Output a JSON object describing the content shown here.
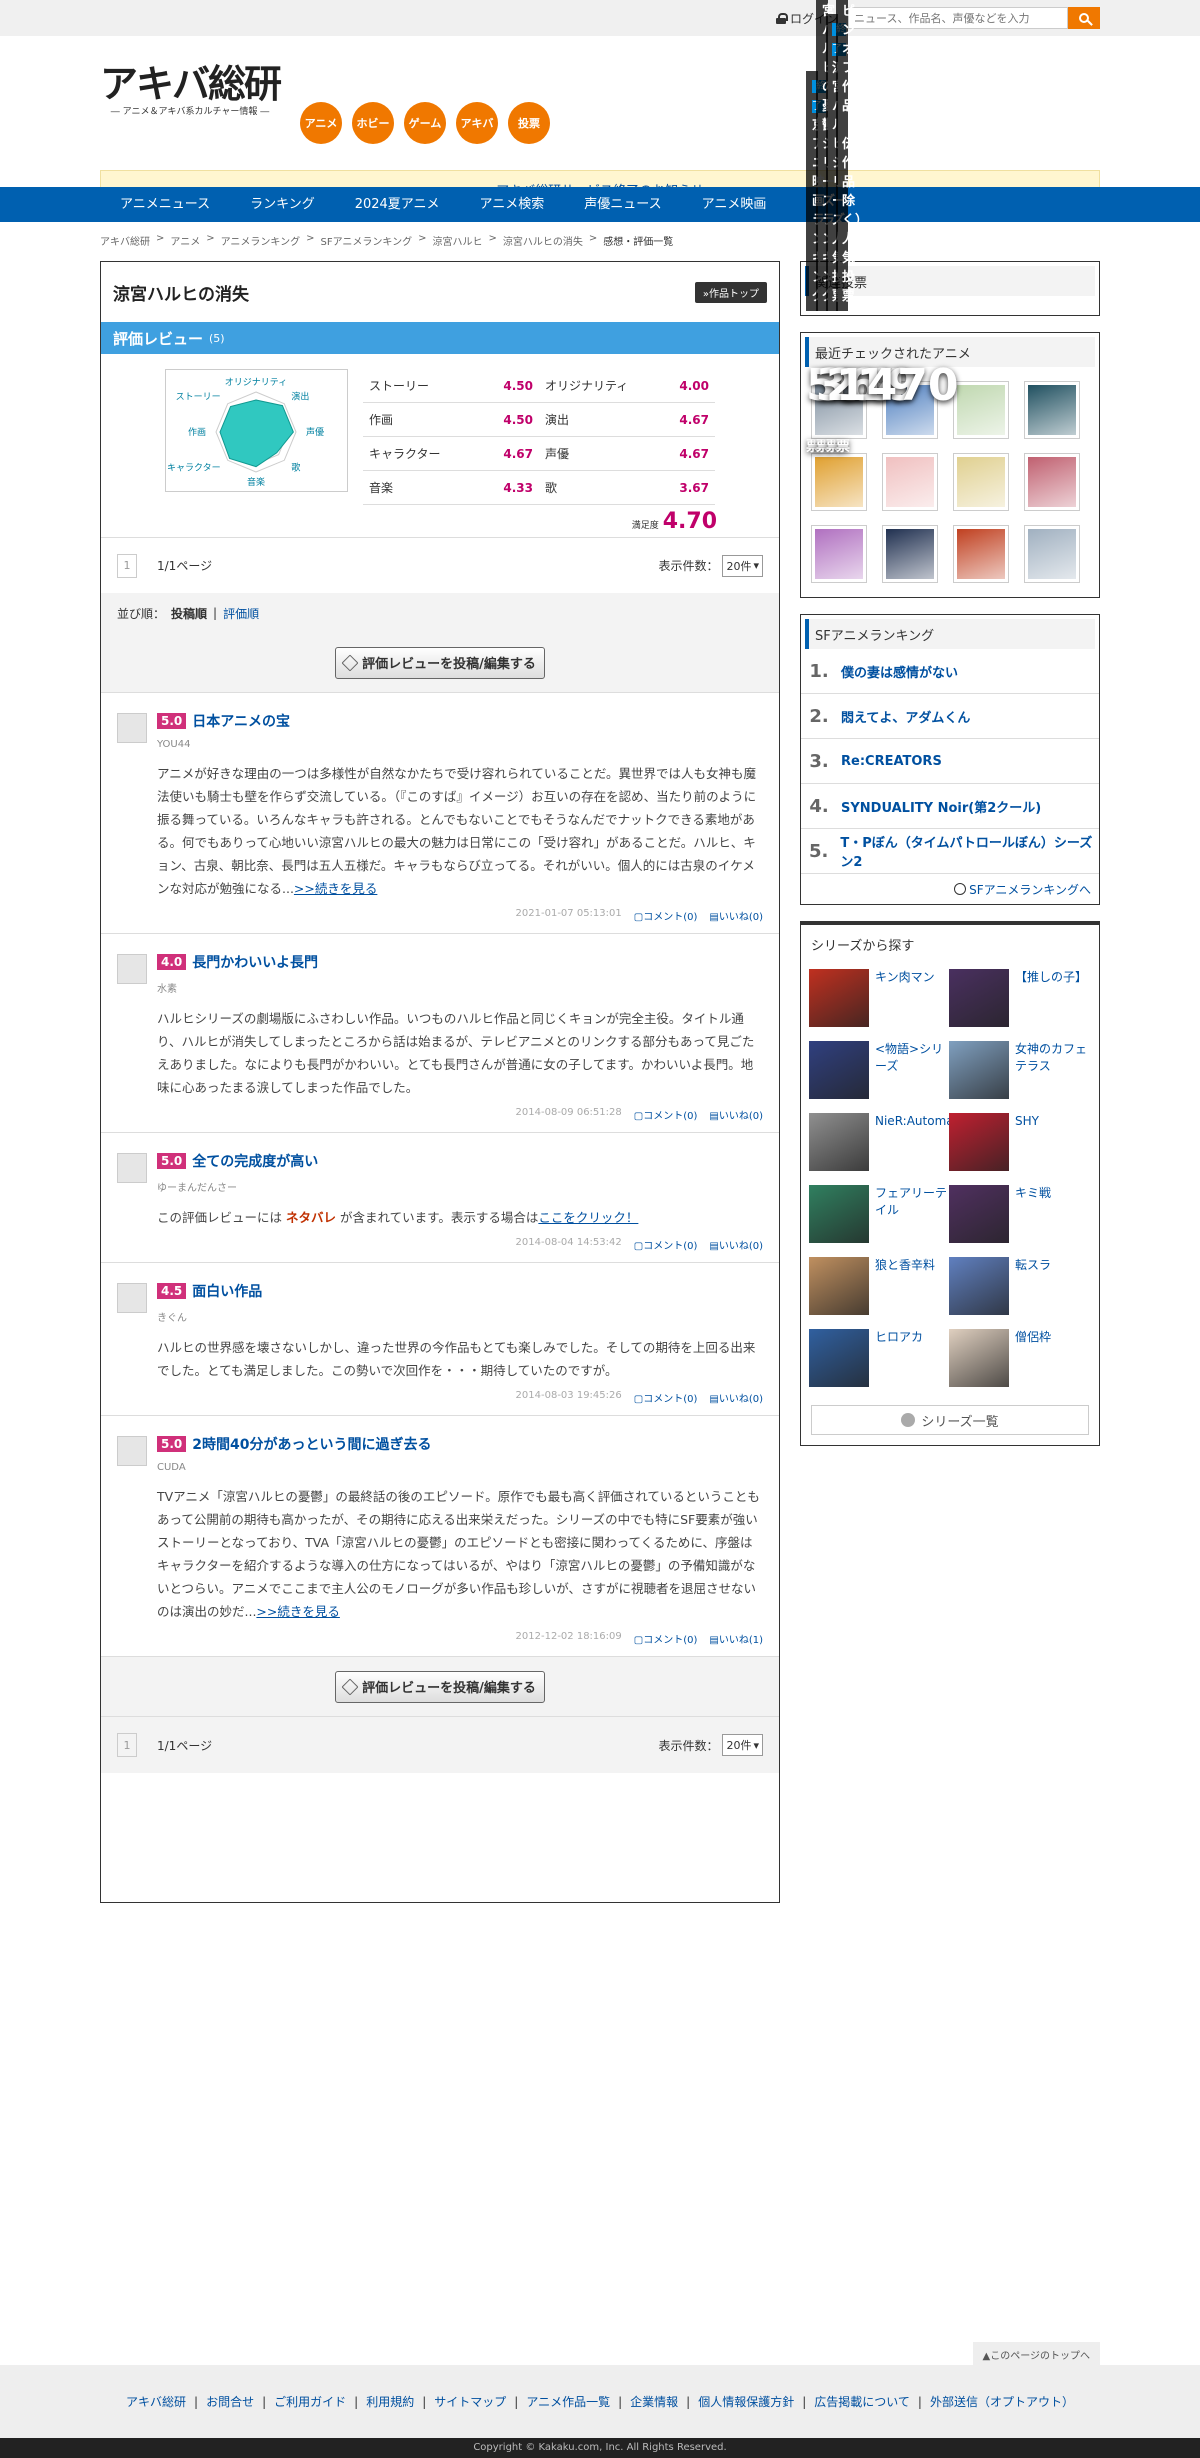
{
  "topbar": {
    "login": "ログイン",
    "search_placeholder": "ニュース、作品名、声優などを入力"
  },
  "logo": {
    "main": "アキバ総研",
    "sub": "― アニメ＆アキバ系カルチャー情報 ―"
  },
  "categories": [
    "アニメ",
    "ホビー",
    "ゲーム",
    "アキバ",
    "投票"
  ],
  "notice": "アキバ総研サービス終了のお知らせ",
  "nav": [
    "アニメニュース",
    "ランキング",
    "2024夏アニメ",
    "アニメ検索",
    "声優ニュース",
    "アニメ映画"
  ],
  "breadcrumb": [
    "アキバ総研",
    "アニメ",
    "アニメランキング",
    "SFアニメランキング",
    "涼宮ハルヒ",
    "涼宮ハルヒの消失",
    "感想・評価一覧"
  ],
  "work": {
    "title": "涼宮ハルヒの消失",
    "top_button": "»作品トップ"
  },
  "reviews_header": {
    "label": "評価レビュー",
    "count": "(5)"
  },
  "radar_labels": [
    "オリジナリティ",
    "演出",
    "声優",
    "歌",
    "音楽",
    "キャラクター",
    "作画",
    "ストーリー"
  ],
  "scores": [
    {
      "label": "ストーリー",
      "value": "4.50"
    },
    {
      "label": "オリジナリティ",
      "value": "4.00"
    },
    {
      "label": "作画",
      "value": "4.50"
    },
    {
      "label": "演出",
      "value": "4.67"
    },
    {
      "label": "キャラクター",
      "value": "4.67"
    },
    {
      "label": "声優",
      "value": "4.67"
    },
    {
      "label": "音楽",
      "value": "4.33"
    },
    {
      "label": "歌",
      "value": "3.67"
    }
  ],
  "overall": {
    "label": "満足度",
    "value": "4.70"
  },
  "pager": {
    "num": "1",
    "pages": "1/1ページ",
    "count_label": "表示件数：",
    "count": "20件"
  },
  "sort": {
    "label": "並び順：",
    "active": "投稿順",
    "other": "評価順"
  },
  "post_button": "評価レビューを投稿/編集する",
  "reviews": [
    {
      "score": "5.0",
      "title": "日本アニメの宝",
      "user": "YOU44",
      "body": "アニメが好きな理由の一つは多様性が自然なかたちで受け容れられていることだ。異世界では人も女神も魔法使いも騎士も壁を作らず交流している。（『このすば』イメージ）お互いの存在を認め、当たり前のように振る舞っている。いろんなキャラも許される。とんでもないことでもそうなんだでナットクできる素地がある。何でもありって心地いい涼宮ハルヒの最大の魅力は日常にこの「受け容れ」があることだ。ハルヒ、キョン、古泉、朝比奈、長門は五人五様だ。キャラもならび立ってる。それがいい。個人的には古泉のイケメンな対応が勉強になる...",
      "more": ">>続きを見る",
      "date": "2021-01-07 05:13:01",
      "comment": "コメント(0)",
      "like": "いいね(0)"
    },
    {
      "score": "4.0",
      "title": "長門かわいいよ長門",
      "user": "水素",
      "body": "ハルヒシリーズの劇場版にふさわしい作品。いつものハルヒ作品と同じくキョンが完全主役。タイトル通り、ハルヒが消失してしまったところから話は始まるが、テレビアニメとのリンクする部分もあって見ごたえありました。なによりも長門がかわいい。とても長門さんが普通に女の子してます。かわいいよ長門。地味に心あったまる涙してしまった作品でした。",
      "more": "",
      "date": "2014-08-09 06:51:28",
      "comment": "コメント(0)",
      "like": "いいね(0)"
    },
    {
      "score": "5.0",
      "title": "全ての完成度が高い",
      "user": "ゆーまんだんさー",
      "spoiler_pre": "この評価レビューには",
      "spoiler_word": "ネタバレ",
      "spoiler_post": "が含まれています。表示する場合は",
      "spoiler_link": "ここをクリック！",
      "date": "2014-08-04 14:53:42",
      "comment": "コメント(0)",
      "like": "いいね(0)"
    },
    {
      "score": "4.5",
      "title": "面白い作品",
      "user": "きぐん",
      "body": "ハルヒの世界感を壊さないしかし、違った世界の今作品もとても楽しみでした。そしての期待を上回る出来でした。とても満足しました。この勢いで次回作を・・・期待していたのですが。",
      "more": "",
      "date": "2014-08-03 19:45:26",
      "comment": "コメント(0)",
      "like": "いいね(0)"
    },
    {
      "score": "5.0",
      "title": "2時間40分があっという間に過ぎ去る",
      "user": "CUDA",
      "body": "TVアニメ「涼宮ハルヒの憂鬱」の最終話の後のエピソード。原作でも最も高く評価されているということもあって公開前の期待も高かったが、その期待に応える出来栄えだった。シリーズの中でも特にSF要素が強いストーリーとなっており、TVA「涼宮ハルヒの憂鬱」のエピソードとも密接に関わってくるために、序盤はキャラクターを紹介するような導入の仕方になってはいるが、やはり「涼宮ハルヒの憂鬱」の予備知識がないとつらい。アニメでここまで主人公のモノローグが多い作品も珍しいが、さすがに視聴者を退屈させないのは演出の妙だ...",
      "more": ">>続きを見る",
      "date": "2012-12-02 18:16:09",
      "comment": "コメント(0)",
      "like": "いいね(1)"
    }
  ],
  "sidebar": {
    "votes_title": "関連投票",
    "votes": [
      {
        "count": "559",
        "unit": "票",
        "badge": "終了",
        "title": "京アニ映画ランキング",
        "c1": "#3a5a80",
        "c2": "#7a6040"
      },
      {
        "count": "364",
        "unit": "票",
        "badge": "終了",
        "title": "涼宮ハルヒの憂鬱シリーズランキング",
        "c1": "#b02020",
        "c2": "#304870"
      },
      {
        "count": "219",
        "unit": "票",
        "badge": "終了",
        "title": "涼宮ハルヒシリーズ人気投票",
        "c1": "#3a5a80",
        "c2": "#6a5040"
      },
      {
        "count": "1470",
        "unit": "票",
        "badge": "終了",
        "title": "スピンオフ作品（外伝作品除く）人気投票",
        "c1": "#2a6a50",
        "c2": "#a02040"
      }
    ],
    "recent_title": "最近チェックされたアニメ",
    "recent": [
      "#8090a0",
      "#5080c0",
      "#c0d8b0",
      "#205060",
      "#e0a030",
      "#f0c0c0",
      "#e0d090",
      "#c06070",
      "#b070c0",
      "#203050",
      "#c04020",
      "#a0b0c0"
    ],
    "ranking_title": "SFアニメランキング",
    "ranking": [
      {
        "n": "1.",
        "t": "僕の妻は感情がない"
      },
      {
        "n": "2.",
        "t": "悶えてよ、アダムくん"
      },
      {
        "n": "3.",
        "t": "Re:CREATORS"
      },
      {
        "n": "4.",
        "t": "SYNDUALITY Noir(第2クール)"
      },
      {
        "n": "5.",
        "t": "T・Pぼん（タイムパトロールぼん）シーズン2"
      }
    ],
    "ranking_more": "SFアニメランキングへ",
    "series_title": "シリーズから探す",
    "series": [
      {
        "t": "キン肉マン",
        "c": "#c03020"
      },
      {
        "t": "【推しの子】",
        "c": "#4a3060"
      },
      {
        "t": "<物語>シリーズ",
        "c": "#304080"
      },
      {
        "t": "女神のカフェテラス",
        "c": "#80a0c0"
      },
      {
        "t": "NieR:Automata",
        "c": "#909090"
      },
      {
        "t": "SHY",
        "c": "#c02030"
      },
      {
        "t": "フェアリーテイル",
        "c": "#308060"
      },
      {
        "t": "キミ戦",
        "c": "#503060"
      },
      {
        "t": "狼と香辛料",
        "c": "#c09060"
      },
      {
        "t": "転スラ",
        "c": "#6080c0"
      },
      {
        "t": "ヒロアカ",
        "c": "#3060a0"
      },
      {
        "t": "僧侶枠",
        "c": "#e0d0c0"
      }
    ],
    "series_more": "シリーズ一覧"
  },
  "pagetop": "▲このページのトップへ",
  "footer": [
    "アキバ総研",
    "お問合せ",
    "ご利用ガイド",
    "利用規約",
    "サイトマップ",
    "アニメ作品一覧",
    "企業情報",
    "個人情報保護方針",
    "広告掲載について",
    "外部送信（オプトアウト）"
  ],
  "copyright": "Copyright © Kakaku.com, Inc. All Rights Reserved."
}
